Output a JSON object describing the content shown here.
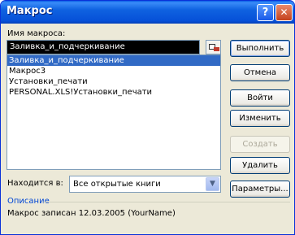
{
  "window": {
    "title": "Макрос",
    "help_glyph": "?",
    "close_glyph": "✕"
  },
  "macro_name": {
    "label": "Имя макроса:",
    "value": "Заливка_и_подчеркивание"
  },
  "macro_list": [
    {
      "label": "Заливка_и_подчеркивание",
      "selected": true
    },
    {
      "label": "Макрос3",
      "selected": false
    },
    {
      "label": "Установки_печати",
      "selected": false
    },
    {
      "label": "PERSONAL.XLS!Установки_печати",
      "selected": false
    }
  ],
  "buttons": {
    "run": "Выполнить",
    "cancel": "Отмена",
    "step_into": "Войти",
    "edit": "Изменить",
    "create": "Создать",
    "delete": "Удалить",
    "options": "Параметры..."
  },
  "location": {
    "label": "Находится в:",
    "value": "Все открытые книги",
    "arrow_icon": "chevron-down-icon"
  },
  "description": {
    "heading": "Описание",
    "text": "Макрос записан 12.03.2005 (YourName)"
  }
}
